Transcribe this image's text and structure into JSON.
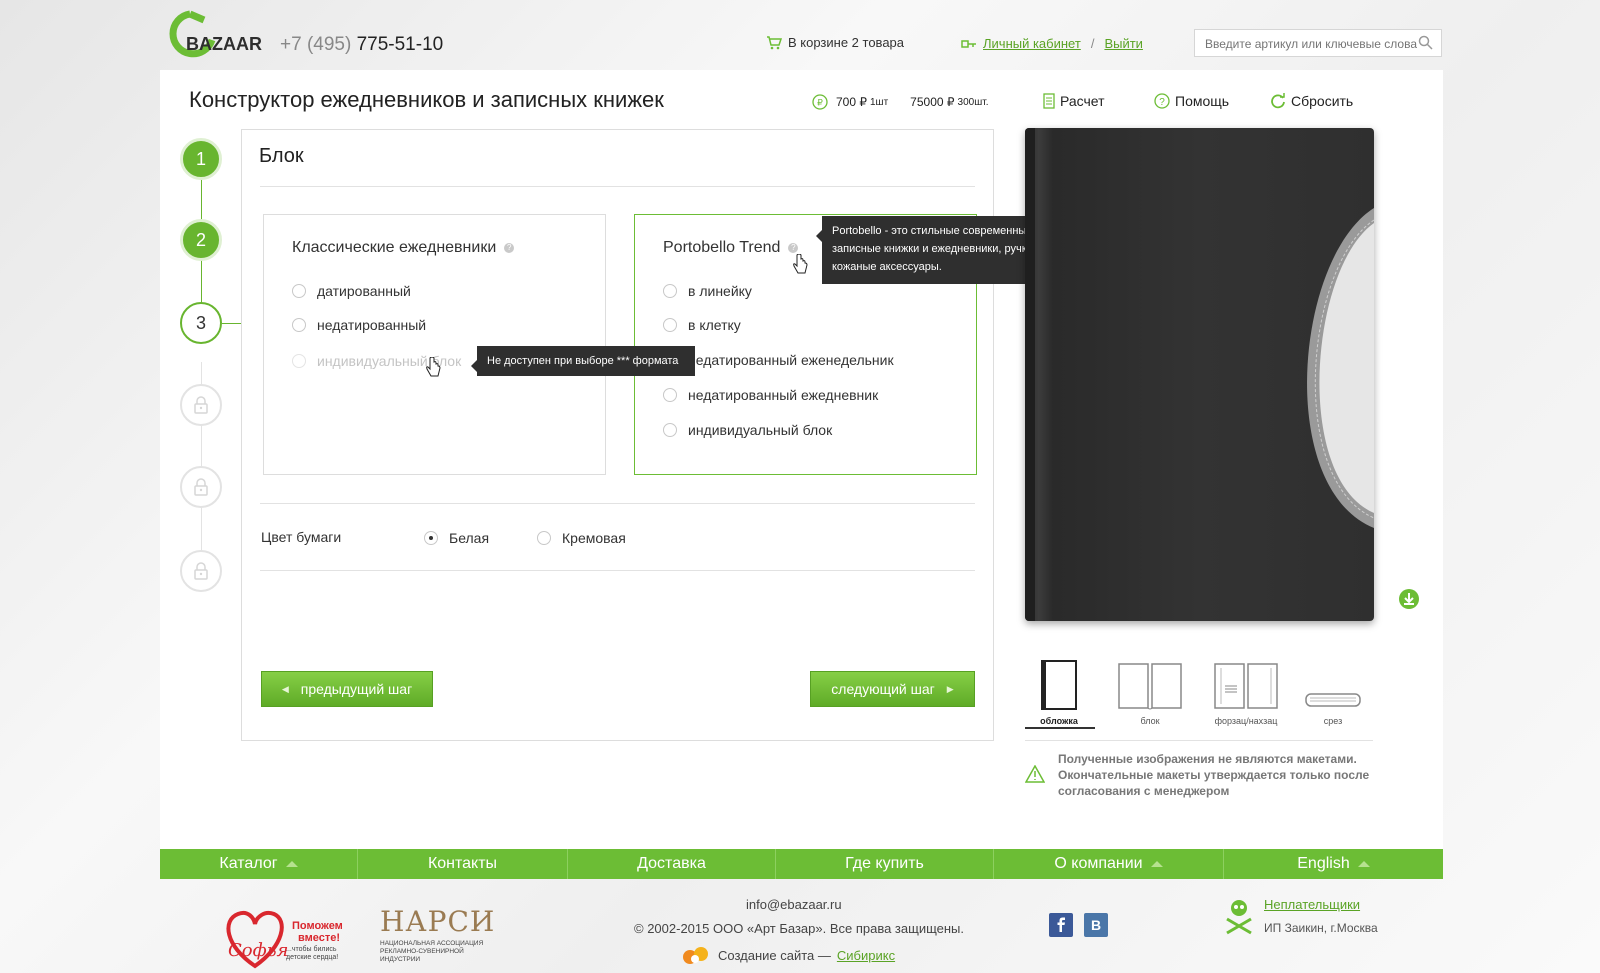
{
  "header": {
    "logo_text": "BAZAAR",
    "phone_code": "+7 (495)",
    "phone_number": "775-51-10",
    "cart_text": "В корзине 2 товара",
    "account_link": "Личный кабинет",
    "separator": "/",
    "logout_link": "Выйти",
    "search_placeholder": "Введите артикул или ключевые слова"
  },
  "toolbar": {
    "page_title": "Конструктор ежедневников и записных книжек",
    "price_unit": "700 ₽",
    "price_unit_qty": "1шт",
    "price_total": "75000 ₽",
    "price_total_qty": "300шт.",
    "calc_label": "Расчет",
    "help_label": "Помощь",
    "reset_label": "Сбросить"
  },
  "steps": [
    {
      "label": "1",
      "state": "done"
    },
    {
      "label": "2",
      "state": "done"
    },
    {
      "label": "3",
      "state": "active"
    },
    {
      "label": "",
      "state": "locked"
    },
    {
      "label": "",
      "state": "locked"
    },
    {
      "label": "",
      "state": "locked"
    }
  ],
  "block": {
    "title": "Блок",
    "classic": {
      "title": "Классические ежедневники",
      "options": [
        "датированный",
        "недатированный",
        "индивидуальный блок"
      ],
      "tooltip": "Не доступен при выборе *** формата"
    },
    "portobello": {
      "title": "Portobello Trend",
      "options": [
        "в линейку",
        "в клетку",
        "недатированный еженедельник",
        "недатированный ежедневник",
        "индивидуальный блок"
      ],
      "tooltip": "Portobello - это стильные современные записные книжки и ежедневники, ручки, кожаные аксессуары."
    },
    "paper_color": {
      "label": "Цвет бумаги",
      "options": [
        "Белая",
        "Кремовая"
      ],
      "selected": "Белая"
    },
    "prev_button": "предыдущий шаг",
    "next_button": "следующий шаг"
  },
  "preview": {
    "thumbs": [
      "обложка",
      "блок",
      "форзац/нахзац",
      "срез"
    ],
    "selected_thumb": "обложка",
    "notice": "Полученные изображения не являются макетами. Окончательные макеты утверждается только после согласования с менеджером"
  },
  "footer": {
    "nav": [
      "Каталог",
      "Контакты",
      "Доставка",
      "Где купить",
      "О компании",
      "English"
    ],
    "charity_line1": "Поможем",
    "charity_line2": "вместе!",
    "charity_line3": "...чтобы бились детские сердца!",
    "charity_script": "Софья",
    "narsi_title": "НАРСИ",
    "narsi_sub": "НАЦИОНАЛЬНАЯ АССОЦИАЦИЯ РЕКЛАМНО-СУВЕНИРНОЙ ИНДУСТРИИ",
    "email": "info@ebazaar.ru",
    "copyright": "© 2002-2015 ООО «Арт Базар». Все права защищены.",
    "created_by": "Создание сайта —",
    "created_by_link": "Сибирикс",
    "nonpayers_link": "Неплательщики",
    "nonpayers_sub": "ИП Заикин, г.Москва"
  },
  "colors": {
    "accent": "#6cbd35",
    "link": "#5aa325",
    "tooltip_bg": "#2f2f2f"
  }
}
